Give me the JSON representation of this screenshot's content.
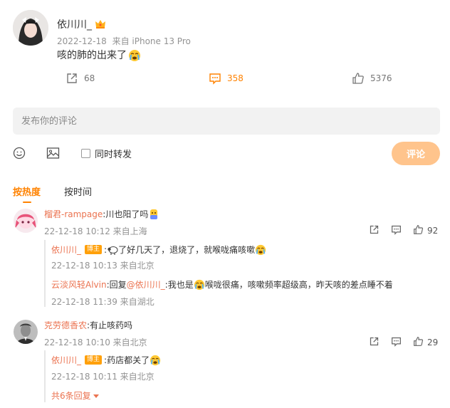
{
  "post": {
    "username": "依川川_",
    "date": "2022-12-18",
    "source": "来自 iPhone 13 Pro",
    "text": "咳的肺的出来了",
    "reposts": "68",
    "comments": "358",
    "likes": "5376"
  },
  "compose": {
    "placeholder": "发布你的评论",
    "repost_label": "同时转发",
    "submit_label": "评论"
  },
  "sort": {
    "hot_label": "按热度",
    "time_label": "按时间"
  },
  "comments": [
    {
      "name": "榴君-rampage",
      "text": ":川也阳了吗",
      "meta": "22-12-18 10:12 来自上海",
      "likes": "92",
      "replies": [
        {
          "name": "依川川_",
          "badge": "博主",
          "text": "了好几天了，退烧了，就喉咙痛咳嗽",
          "meta": "22-12-18 10:13 来自北京"
        },
        {
          "name": "云淡风轻Alvin",
          "reply_word": ":回复",
          "mention": "@依川川_",
          "text_a": ":我也是",
          "text_b": "喉咙很痛，咳嗽频率超级高，昨天咳的差点睡不着",
          "meta": "22-12-18 11:39 来自湖北"
        }
      ]
    },
    {
      "name": "克劳德香农",
      "text": ":有止咳药吗",
      "meta": "22-12-18 10:10 来自北京",
      "likes": "29",
      "replies": [
        {
          "name": "依川川_",
          "badge": "博主",
          "text": ":药店都关了",
          "meta": "22-12-18 10:11 来自北京"
        }
      ],
      "more_replies": "共6条回复"
    }
  ],
  "colors": {
    "accent": "#ff8200",
    "name": "#eb7350",
    "submit_bg": "#ffc48c",
    "meta": "#939393"
  }
}
